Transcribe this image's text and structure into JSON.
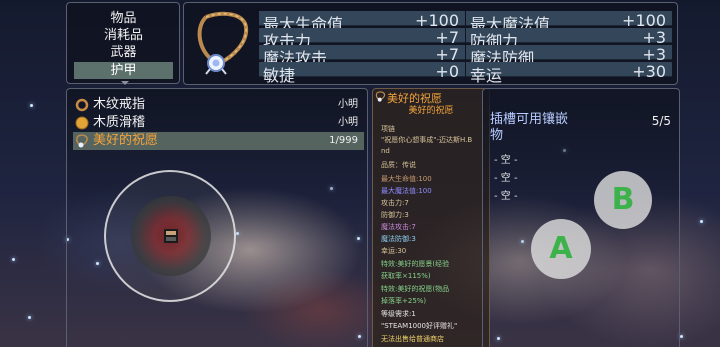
{
  "categories": [
    {
      "label": "物品"
    },
    {
      "label": "消耗品"
    },
    {
      "label": "武器"
    },
    {
      "label": "护甲"
    }
  ],
  "stats": {
    "left": [
      {
        "label": "最大生命值",
        "value": "+100"
      },
      {
        "label": "攻击力",
        "value": "+7"
      },
      {
        "label": "魔法攻击",
        "value": "+7"
      },
      {
        "label": "敏捷",
        "value": "+0"
      }
    ],
    "right": [
      {
        "label": "最大魔法值",
        "value": "+100"
      },
      {
        "label": "防御力",
        "value": "+3"
      },
      {
        "label": "魔法防御",
        "value": "+3"
      },
      {
        "label": "幸运",
        "value": "+30"
      }
    ]
  },
  "items": [
    {
      "name": "木纹戒指",
      "owner": "小明"
    },
    {
      "name": "木质滑稽",
      "owner": "小明"
    },
    {
      "name": "美好的祝愿",
      "owner": "1/999"
    }
  ],
  "detail": {
    "title": "美好的祝愿",
    "subtitle": "美好的祝愿",
    "lines": [
      "项链",
      "\"祝愿你心想事成\"-迈达斯H.B",
      "nd",
      "品质：传说",
      "最大生命值:100",
      "最大魔法值:100",
      "攻击力:7",
      "防御力:3",
      "魔法攻击:7",
      "魔法防御:3",
      "幸运:30",
      "特效:美好的愿景(经验",
      "获取率×115%)",
      "特效:美好的祝愿(物品",
      "掉落率+25%)",
      "等级需求:1",
      "\"STEAM1000好评赠礼\"",
      "无法出售给普通商店"
    ]
  },
  "sockets": {
    "title": "插槽可用镶嵌物",
    "count": "5/5",
    "slots": [
      "- 空 -",
      "- 空 -",
      "- 空 -"
    ]
  },
  "controls": {
    "a_label": "A",
    "b_label": "B"
  },
  "colors": {
    "selected_item": "#f2a33a",
    "socket_title": "#b9ccff",
    "button_letter": "#3bb24a"
  }
}
